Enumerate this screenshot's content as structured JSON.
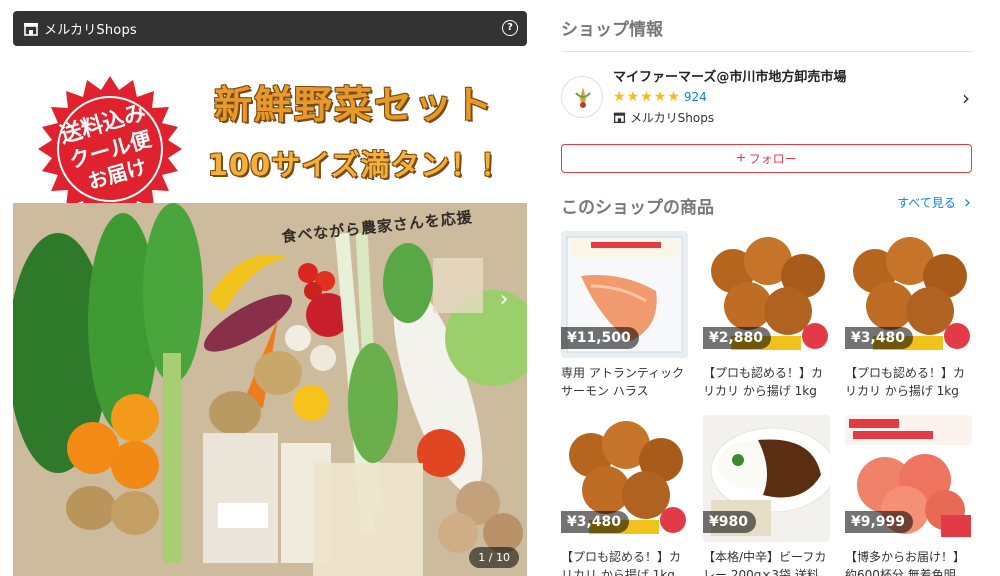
{
  "gallery": {
    "brand": "メルカリShops",
    "badge_lines": [
      "送料込み",
      "クール便",
      "お届け"
    ],
    "headline": "新鮮野菜セット",
    "subline": "100サイズ満タン！！",
    "photo_caption": "食べながら農家さんを応援",
    "pager": "1 / 10"
  },
  "shop_info": {
    "title": "ショップ情報",
    "name": "マイファーマーズ@市川市地方卸売市場",
    "rating": 5,
    "review_count": "924",
    "shops_label": "メルカリShops",
    "follow_label": "フォロー"
  },
  "products": {
    "title": "このショップの商品",
    "see_all": "すべて見る",
    "items": [
      {
        "price": "¥11,500",
        "title": "専用 アトランティックサーモン ハラス"
      },
      {
        "price": "¥2,880",
        "title": "【プロも認める！】カリカリ から揚げ 1kg"
      },
      {
        "price": "¥3,480",
        "title": "【プロも認める！】カリカリ から揚げ 1kg"
      },
      {
        "price": "¥3,480",
        "title": "【プロも認める！】カリカリ から揚げ 1kg"
      },
      {
        "price": "¥980",
        "title": "【本格/中辛】ビーフカレー 200g×3袋 送料"
      },
      {
        "price": "¥9,999",
        "title": "【博多からお届け！】約600杯分 無着色明"
      }
    ]
  },
  "colors": {
    "accent_red": "#e33b45",
    "link_blue": "#0b84e3",
    "star": "#ffb818",
    "bar_dark": "#333333"
  }
}
